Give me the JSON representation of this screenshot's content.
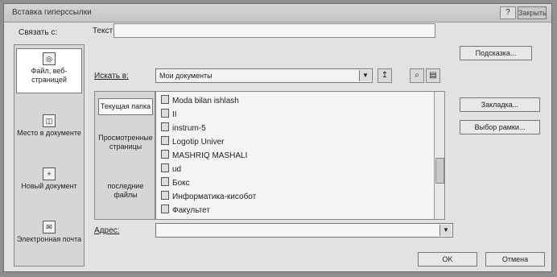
{
  "dialog": {
    "title": "Вставка гиперссылки",
    "help_label": "?",
    "close_label": "Закрыть"
  },
  "link_to": {
    "label": "Связать с:",
    "items": [
      {
        "label": "Файл, веб-страницей",
        "icon": "globe-file-icon"
      },
      {
        "label": "Место в документе",
        "icon": "document-place-icon"
      },
      {
        "label": "Новый документ",
        "icon": "new-document-icon"
      },
      {
        "label": "Электронная почта",
        "icon": "email-icon"
      }
    ]
  },
  "text_field": {
    "label": "Текст:",
    "value": ""
  },
  "look_in": {
    "label": "Искать в:",
    "value": "Мои документы"
  },
  "side_items": [
    {
      "label": "Текущая папка"
    },
    {
      "label": "Просмотренные страницы"
    },
    {
      "label": "последние файлы"
    }
  ],
  "files": [
    "Moda bilan ishlash",
    "II",
    "instrum-5",
    "Logotip Univer",
    "MASHRIQ MASHALI",
    "ud",
    "Бокс",
    "Информатика-кисобот",
    "Факультет"
  ],
  "address": {
    "label": "Адрес:",
    "value": ""
  },
  "buttons": {
    "tooltip": "Подсказка...",
    "bookmark": "Закладка...",
    "frame": "Выбор рамки...",
    "ok": "OK",
    "cancel": "Отмена"
  }
}
